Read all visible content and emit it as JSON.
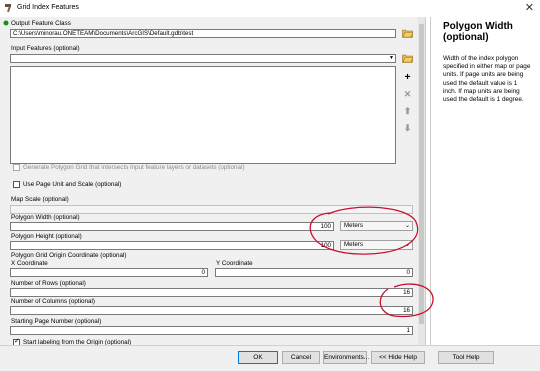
{
  "window": {
    "title": "Grid Index Features",
    "close_label": "✕"
  },
  "form": {
    "output_label": "Output Feature Class",
    "output_value": "C:\\Users\\minorau.ONETEAM\\Documents\\ArcGIS\\Default.gdb\\test",
    "input_label": "Input Features (optional)",
    "input_value": "",
    "generate_grid_label": "Generate Polygon Grid that intersects input feature layers or datasets (optional)",
    "use_page_unit_label": "Use Page Unit and Scale (optional)",
    "map_scale_label": "Map Scale (optional)",
    "map_scale_value": "",
    "polygon_width_label": "Polygon Width (optional)",
    "polygon_width_value": "100",
    "polygon_width_unit": "Meters",
    "polygon_height_label": "Polygon Height (optional)",
    "polygon_height_value": "100",
    "polygon_height_unit": "Meters",
    "origin_label": "Polygon Grid Origin Coordinate (optional)",
    "x_label": "X Coordinate",
    "x_value": "0",
    "y_label": "Y Coordinate",
    "y_value": "0",
    "rows_label": "Number of Rows (optional)",
    "rows_value": "16",
    "cols_label": "Number of Columns (optional)",
    "cols_value": "16",
    "start_page_label": "Starting Page Number (optional)",
    "start_page_value": "1",
    "start_label_origin_label": "Start labeling from the Origin (optional)"
  },
  "help": {
    "title": "Polygon Width (optional)",
    "body": "Width of the index polygon specified in either map or page units. If page units are being used the default value is 1 inch. If map units are being used the default is 1 degree."
  },
  "buttons": {
    "ok": "OK",
    "cancel": "Cancel",
    "environments": "Environments...",
    "hide_help": "<< Hide Help",
    "tool_help": "Tool Help"
  },
  "colors": {
    "annotation": "#c8102e",
    "accent": "#0078d7"
  }
}
